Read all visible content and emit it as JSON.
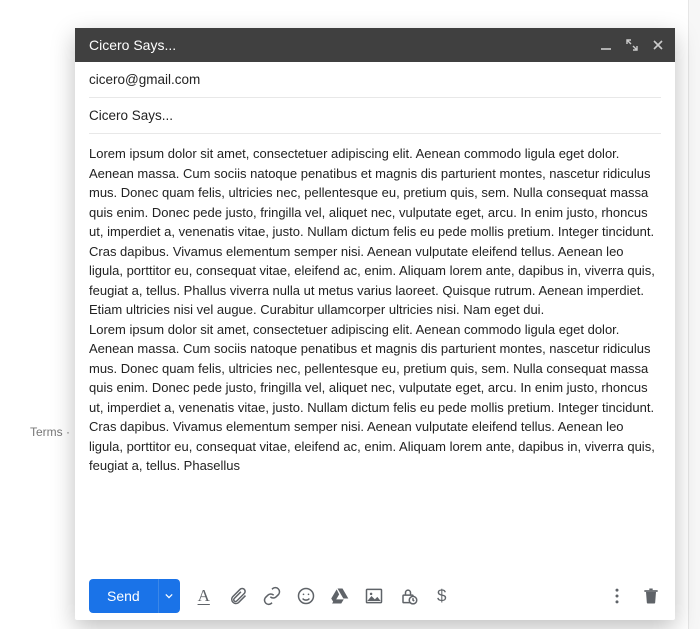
{
  "footer": {
    "terms": "Terms ·"
  },
  "compose": {
    "title": "Cicero Says...",
    "to": "cicero@gmail.com",
    "subject": "Cicero Says...",
    "body": "Lorem ipsum dolor sit amet, consectetuer adipiscing elit. Aenean commodo ligula eget dolor. Aenean massa. Cum sociis natoque penatibus et magnis dis parturient montes, nascetur ridiculus mus. Donec quam felis, ultricies nec, pellentesque eu, pretium quis, sem. Nulla consequat massa quis enim. Donec pede justo, fringilla vel, aliquet nec, vulputate eget, arcu. In enim justo, rhoncus ut, imperdiet a, venenatis vitae, justo. Nullam dictum felis eu pede mollis pretium. Integer tincidunt. Cras dapibus. Vivamus elementum semper nisi. Aenean vulputate eleifend tellus. Aenean leo ligula, porttitor eu, consequat vitae, eleifend ac, enim. Aliquam lorem ante, dapibus in, viverra quis, feugiat a, tellus. Phallus viverra nulla ut metus varius laoreet. Quisque rutrum. Aenean imperdiet. Etiam ultricies nisi vel augue. Curabitur ullamcorper ultricies nisi. Nam eget dui.\nLorem ipsum dolor sit amet, consectetuer adipiscing elit. Aenean commodo ligula eget dolor. Aenean massa. Cum sociis natoque penatibus et magnis dis parturient montes, nascetur ridiculus mus. Donec quam felis, ultricies nec, pellentesque eu, pretium quis, sem. Nulla consequat massa quis enim. Donec pede justo, fringilla vel, aliquet nec, vulputate eget, arcu. In enim justo, rhoncus ut, imperdiet a, venenatis vitae, justo. Nullam dictum felis eu pede mollis pretium. Integer tincidunt. Cras dapibus. Vivamus elementum semper nisi. Aenean vulputate eleifend tellus. Aenean leo ligula, porttitor eu, consequat vitae, eleifend ac, enim. Aliquam lorem ante, dapibus in, viverra quis, feugiat a, tellus. Phasellus"
  },
  "toolbar": {
    "send_label": "Send"
  }
}
